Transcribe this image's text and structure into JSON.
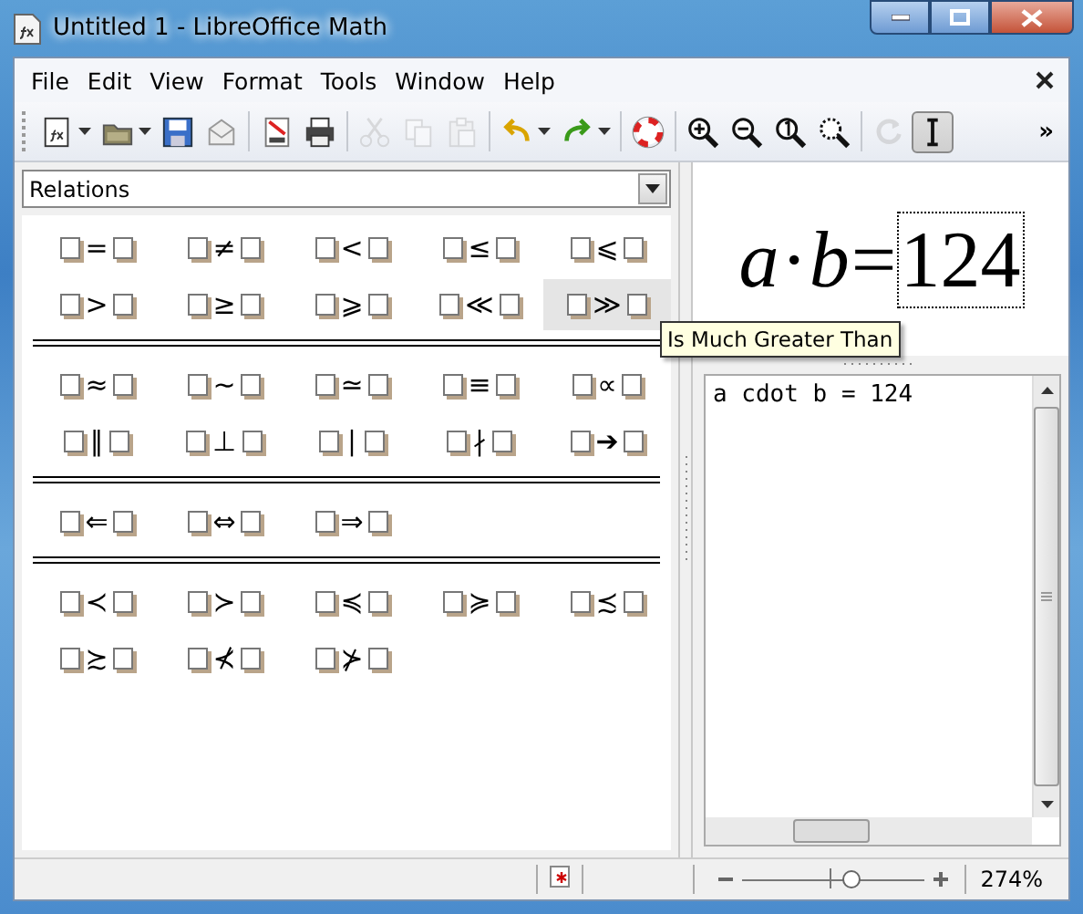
{
  "window": {
    "title": "Untitled 1 - LibreOffice Math"
  },
  "menu": [
    {
      "label": "File"
    },
    {
      "label": "Edit"
    },
    {
      "label": "View"
    },
    {
      "label": "Format"
    },
    {
      "label": "Tools"
    },
    {
      "label": "Window"
    },
    {
      "label": "Help"
    }
  ],
  "toolbar": [
    [
      {
        "kind": "new",
        "disabled": false,
        "on": false,
        "dropdown": true
      },
      {
        "kind": "open",
        "disabled": false,
        "on": false,
        "dropdown": true
      },
      {
        "kind": "save",
        "disabled": false,
        "on": false,
        "dropdown": false
      },
      {
        "kind": "mail",
        "disabled": false,
        "on": false,
        "dropdown": false
      }
    ],
    [
      {
        "kind": "pdf",
        "disabled": false,
        "on": false,
        "dropdown": false
      },
      {
        "kind": "print",
        "disabled": false,
        "on": false,
        "dropdown": false
      }
    ],
    [
      {
        "kind": "cut",
        "disabled": true,
        "on": false,
        "dropdown": false
      },
      {
        "kind": "copy",
        "disabled": true,
        "on": false,
        "dropdown": false
      },
      {
        "kind": "paste",
        "disabled": true,
        "on": false,
        "dropdown": false
      }
    ],
    [
      {
        "kind": "undo",
        "disabled": false,
        "on": false,
        "dropdown": true
      },
      {
        "kind": "redo",
        "disabled": false,
        "on": false,
        "dropdown": true
      }
    ],
    [
      {
        "kind": "help",
        "disabled": false,
        "on": false,
        "dropdown": false
      }
    ],
    [
      {
        "kind": "zoom-in",
        "disabled": false,
        "on": false,
        "dropdown": false
      },
      {
        "kind": "zoom-out",
        "disabled": false,
        "on": false,
        "dropdown": false
      },
      {
        "kind": "zoom-100",
        "disabled": false,
        "on": false,
        "dropdown": false
      },
      {
        "kind": "zoom-all",
        "disabled": false,
        "on": false,
        "dropdown": false
      }
    ],
    [
      {
        "kind": "update",
        "disabled": true,
        "on": false,
        "dropdown": false
      },
      {
        "kind": "cursor",
        "disabled": false,
        "on": true,
        "dropdown": false
      }
    ]
  ],
  "toolbar_overflow": "»",
  "category": {
    "value": "Relations"
  },
  "symbol_groups": [
    [
      {
        "symbol": "=",
        "hovered": false
      },
      {
        "symbol": "≠",
        "hovered": false
      },
      {
        "symbol": "<",
        "hovered": false
      },
      {
        "symbol": "≤",
        "hovered": false
      },
      {
        "symbol": "⩽",
        "hovered": false
      },
      {
        "symbol": ">",
        "hovered": false
      },
      {
        "symbol": "≥",
        "hovered": false
      },
      {
        "symbol": "⩾",
        "hovered": false
      },
      {
        "symbol": "≪",
        "hovered": false
      },
      {
        "symbol": "≫",
        "hovered": true
      }
    ],
    [
      {
        "symbol": "≈",
        "hovered": false
      },
      {
        "symbol": "∼",
        "hovered": false
      },
      {
        "symbol": "≃",
        "hovered": false
      },
      {
        "symbol": "≡",
        "hovered": false
      },
      {
        "symbol": "∝",
        "hovered": false
      },
      {
        "symbol": "∥",
        "hovered": false
      },
      {
        "symbol": "⊥",
        "hovered": false
      },
      {
        "symbol": "∣",
        "hovered": false
      },
      {
        "symbol": "∤",
        "hovered": false
      },
      {
        "symbol": "➔",
        "hovered": false
      }
    ],
    [
      {
        "symbol": "⇐",
        "hovered": false
      },
      {
        "symbol": "⇔",
        "hovered": false
      },
      {
        "symbol": "⇒",
        "hovered": false
      }
    ],
    [
      {
        "symbol": "≺",
        "hovered": false
      },
      {
        "symbol": "≻",
        "hovered": false
      },
      {
        "symbol": "≼",
        "hovered": false
      },
      {
        "symbol": "≽",
        "hovered": false
      },
      {
        "symbol": "≾",
        "hovered": false
      },
      {
        "symbol": "≿",
        "hovered": false
      },
      {
        "symbol": "⊀",
        "hovered": false
      },
      {
        "symbol": "⊁",
        "hovered": false
      }
    ]
  ],
  "tooltip": "Is Much Greater Than",
  "formula": [
    {
      "text": "a",
      "kind": "variable",
      "selected": false
    },
    {
      "text": "·",
      "kind": "operator",
      "selected": false
    },
    {
      "text": "b",
      "kind": "variable",
      "selected": false
    },
    {
      "text": "=",
      "kind": "operator",
      "selected": false
    },
    {
      "text": "124",
      "kind": "number",
      "selected": true
    }
  ],
  "command": "a cdot b = 124",
  "status_bar": {
    "modified": true,
    "zoom": {
      "level": 0.6,
      "reading": "274%"
    }
  }
}
